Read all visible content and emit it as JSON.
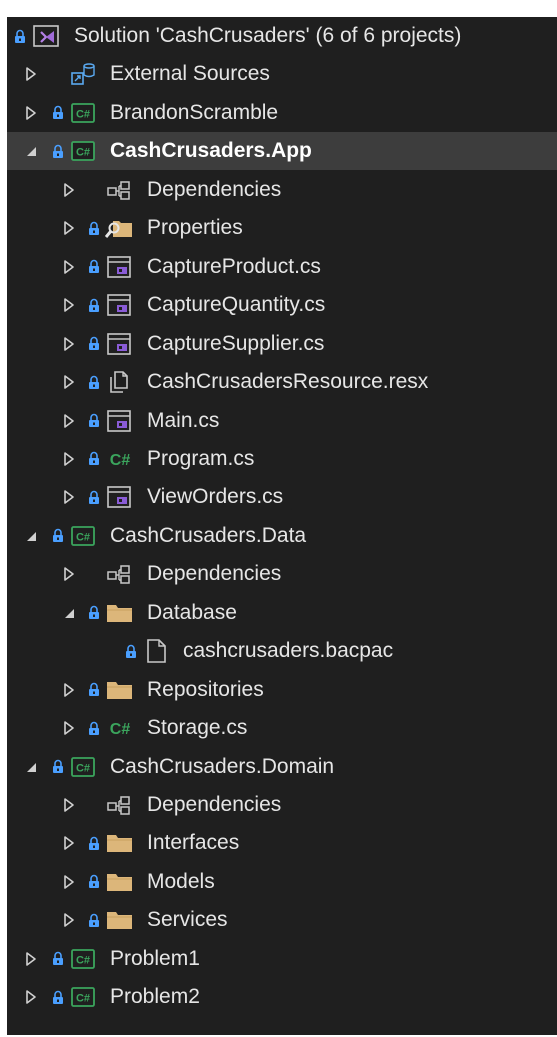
{
  "colors": {
    "background": "#1f1f1f",
    "selected_row": "#3d3d3d",
    "text": "#e6e6e6",
    "lock_blue": "#4a9fff",
    "csharp_green": "#3ba55d",
    "folder": "#dcb67a",
    "form_purple": "#8a5cd6"
  },
  "tree": [
    {
      "label": "Solution 'CashCrusaders' (6 of 6 projects)",
      "level": 0,
      "expander": "none",
      "lock": true,
      "icon": "solution-icon",
      "selected": false,
      "name": "solution"
    },
    {
      "label": "External Sources",
      "level": 1,
      "expander": "collapsed",
      "lock": false,
      "icon": "external-sources-icon",
      "selected": false,
      "name": "external-sources"
    },
    {
      "label": "BrandonScramble",
      "level": 1,
      "expander": "collapsed",
      "lock": true,
      "icon": "csharp-project-icon",
      "selected": false,
      "name": "brandonscramble"
    },
    {
      "label": "CashCrusaders.App",
      "level": 1,
      "expander": "expanded",
      "lock": true,
      "icon": "csharp-project-icon",
      "selected": true,
      "name": "cashcrusaders-app"
    },
    {
      "label": "Dependencies",
      "level": 2,
      "expander": "collapsed",
      "lock": false,
      "icon": "dependencies-icon",
      "selected": false,
      "name": "app-dependencies"
    },
    {
      "label": "Properties",
      "level": 2,
      "expander": "collapsed",
      "lock": true,
      "icon": "properties-icon",
      "selected": false,
      "name": "properties"
    },
    {
      "label": "CaptureProduct.cs",
      "level": 2,
      "expander": "collapsed",
      "lock": true,
      "icon": "form-icon",
      "selected": false,
      "name": "captureproduct"
    },
    {
      "label": "CaptureQuantity.cs",
      "level": 2,
      "expander": "collapsed",
      "lock": true,
      "icon": "form-icon",
      "selected": false,
      "name": "capturequantity"
    },
    {
      "label": "CaptureSupplier.cs",
      "level": 2,
      "expander": "collapsed",
      "lock": true,
      "icon": "form-icon",
      "selected": false,
      "name": "capturesupplier"
    },
    {
      "label": "CashCrusadersResource.resx",
      "level": 2,
      "expander": "collapsed",
      "lock": true,
      "icon": "resource-icon",
      "selected": false,
      "name": "resource-resx"
    },
    {
      "label": "Main.cs",
      "level": 2,
      "expander": "collapsed",
      "lock": true,
      "icon": "form-icon",
      "selected": false,
      "name": "main-cs"
    },
    {
      "label": "Program.cs",
      "level": 2,
      "expander": "collapsed",
      "lock": true,
      "icon": "csharp-file-icon",
      "selected": false,
      "name": "program-cs"
    },
    {
      "label": "ViewOrders.cs",
      "level": 2,
      "expander": "collapsed",
      "lock": true,
      "icon": "form-icon",
      "selected": false,
      "name": "vieworders"
    },
    {
      "label": "CashCrusaders.Data",
      "level": 1,
      "expander": "expanded",
      "lock": true,
      "icon": "csharp-project-icon",
      "selected": false,
      "name": "cashcrusaders-data"
    },
    {
      "label": "Dependencies",
      "level": 2,
      "expander": "collapsed",
      "lock": false,
      "icon": "dependencies-icon",
      "selected": false,
      "name": "data-dependencies"
    },
    {
      "label": "Database",
      "level": 2,
      "expander": "expanded",
      "lock": true,
      "icon": "folder-icon",
      "selected": false,
      "name": "database-folder"
    },
    {
      "label": "cashcrusaders.bacpac",
      "level": 3,
      "expander": "none",
      "lock": true,
      "icon": "file-icon",
      "selected": false,
      "name": "bacpac-file"
    },
    {
      "label": "Repositories",
      "level": 2,
      "expander": "collapsed",
      "lock": true,
      "icon": "folder-icon",
      "selected": false,
      "name": "repositories-folder"
    },
    {
      "label": "Storage.cs",
      "level": 2,
      "expander": "collapsed",
      "lock": true,
      "icon": "csharp-file-icon",
      "selected": false,
      "name": "storage-cs"
    },
    {
      "label": "CashCrusaders.Domain",
      "level": 1,
      "expander": "expanded",
      "lock": true,
      "icon": "csharp-project-icon",
      "selected": false,
      "name": "cashcrusaders-domain"
    },
    {
      "label": "Dependencies",
      "level": 2,
      "expander": "collapsed",
      "lock": false,
      "icon": "dependencies-icon",
      "selected": false,
      "name": "domain-dependencies"
    },
    {
      "label": "Interfaces",
      "level": 2,
      "expander": "collapsed",
      "lock": true,
      "icon": "folder-icon",
      "selected": false,
      "name": "interfaces-folder"
    },
    {
      "label": "Models",
      "level": 2,
      "expander": "collapsed",
      "lock": true,
      "icon": "folder-icon",
      "selected": false,
      "name": "models-folder"
    },
    {
      "label": "Services",
      "level": 2,
      "expander": "collapsed",
      "lock": true,
      "icon": "folder-icon",
      "selected": false,
      "name": "services-folder"
    },
    {
      "label": "Problem1",
      "level": 1,
      "expander": "collapsed",
      "lock": true,
      "icon": "csharp-project-icon",
      "selected": false,
      "name": "problem1"
    },
    {
      "label": "Problem2",
      "level": 1,
      "expander": "collapsed",
      "lock": true,
      "icon": "csharp-project-icon",
      "selected": false,
      "name": "problem2"
    }
  ]
}
